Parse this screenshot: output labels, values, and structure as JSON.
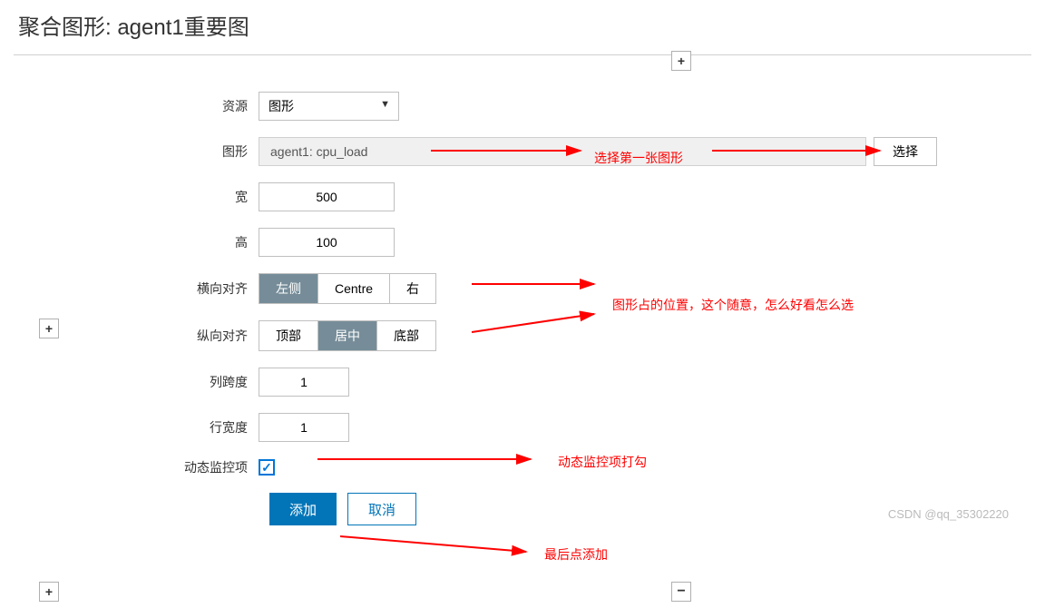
{
  "page": {
    "title": "聚合图形: agent1重要图"
  },
  "form": {
    "resource_label": "资源",
    "resource_value": "图形",
    "graph_label": "图形",
    "graph_value": "agent1: cpu_load",
    "select_button": "选择",
    "width_label": "宽",
    "width_value": "500",
    "height_label": "高",
    "height_value": "100",
    "halign_label": "横向对齐",
    "halign_options": [
      "左侧",
      "Centre",
      "右"
    ],
    "halign_selected": 0,
    "valign_label": "纵向对齐",
    "valign_options": [
      "顶部",
      "居中",
      "底部"
    ],
    "valign_selected": 1,
    "colspan_label": "列跨度",
    "colspan_value": "1",
    "rowspan_label": "行宽度",
    "rowspan_value": "1",
    "dynamic_label": "动态监控项",
    "dynamic_checked": true,
    "add_button": "添加",
    "cancel_button": "取消"
  },
  "annotations": {
    "select_first": "选择第一张图形",
    "position_note": "图形占的位置，这个随意，怎么好看怎么选",
    "dynamic_note": "动态监控项打勾",
    "add_note": "最后点添加"
  },
  "watermark": "CSDN @qq_35302220"
}
